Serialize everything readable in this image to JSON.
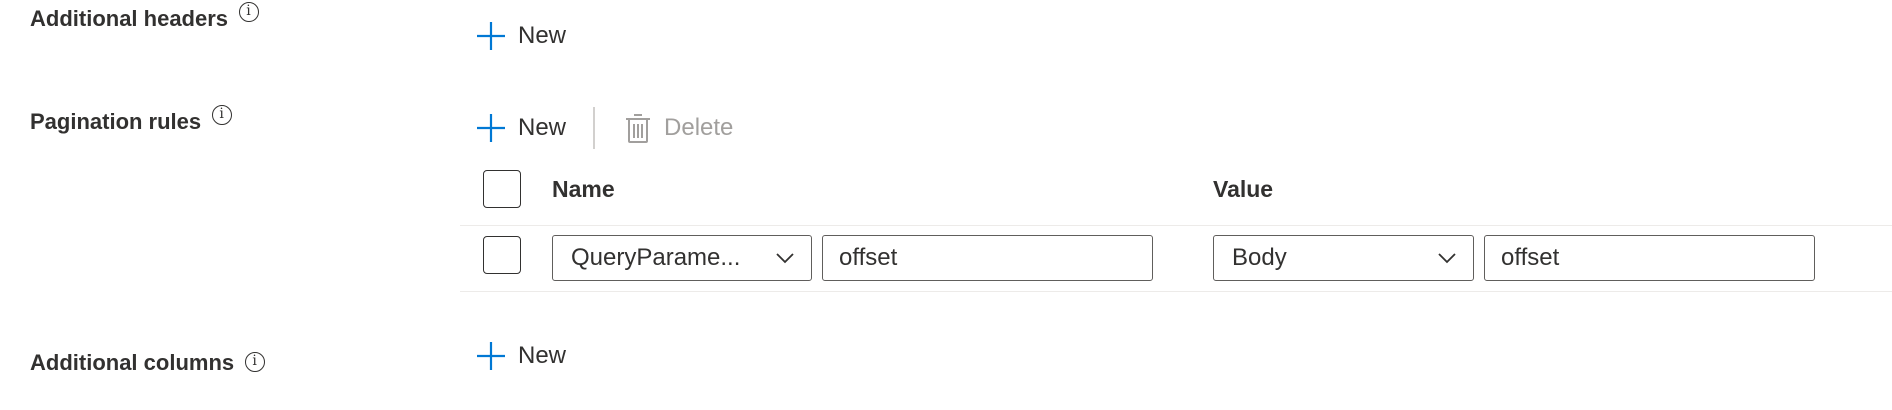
{
  "additional_headers": {
    "label": "Additional headers",
    "new_label": "New"
  },
  "pagination_rules": {
    "label": "Pagination rules",
    "new_label": "New",
    "delete_label": "Delete",
    "columns": {
      "name": "Name",
      "value": "Value"
    },
    "rows": [
      {
        "name_type": "QueryParame...",
        "name_value": "offset",
        "value_type": "Body",
        "value_value": "offset"
      }
    ]
  },
  "additional_columns": {
    "label": "Additional columns",
    "new_label": "New"
  },
  "info_glyph": "i",
  "accent_color": "#0078d4",
  "icons": {
    "add": "plus-icon",
    "delete": "trash-icon",
    "info": "info-icon",
    "dropdown": "chevron-down-icon"
  }
}
